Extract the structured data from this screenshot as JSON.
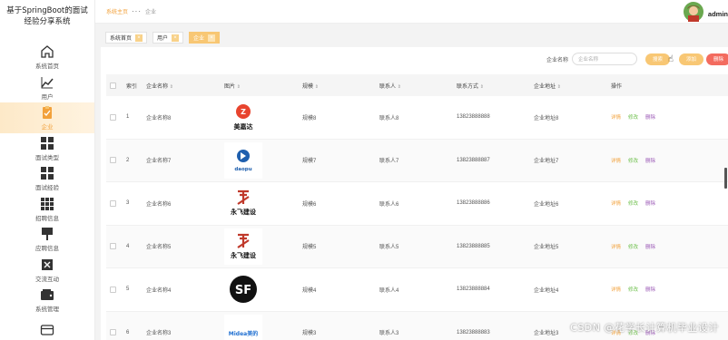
{
  "app": {
    "title": "基于SpringBoot的面试经验分享系统"
  },
  "sidebar": {
    "items": [
      {
        "label": "系统首页",
        "icon": "home-icon",
        "active": false
      },
      {
        "label": "用户",
        "icon": "chart-line-icon",
        "active": false
      },
      {
        "label": "企业",
        "icon": "clipboard-check-icon",
        "active": true
      },
      {
        "label": "面试类型",
        "icon": "grid-icon",
        "active": false
      },
      {
        "label": "面试经验",
        "icon": "grid-icon",
        "active": false
      },
      {
        "label": "招聘信息",
        "icon": "apps-icon",
        "active": false
      },
      {
        "label": "应聘信息",
        "icon": "pin-icon",
        "active": false
      },
      {
        "label": "交流互动",
        "icon": "chat-x-icon",
        "active": false
      },
      {
        "label": "系统管理",
        "icon": "wallet-icon",
        "active": false
      },
      {
        "label": "",
        "icon": "card-icon",
        "active": false
      }
    ]
  },
  "header": {
    "breadcrumb": [
      "系统主页",
      "···",
      "企业"
    ],
    "user": {
      "name": "admin",
      "icon": "avatar-icon"
    }
  },
  "tags": [
    {
      "label": "系统首页",
      "active": false
    },
    {
      "label": "用户",
      "active": false
    },
    {
      "label": "企业",
      "active": true
    }
  ],
  "search": {
    "label": "企业名称",
    "placeholder": "企业名称",
    "search_label": "搜索",
    "add_label": "添加",
    "delete_label": "删除"
  },
  "table": {
    "columns": [
      "索引",
      "企业名称",
      "图片",
      "规模",
      "联系人",
      "联系方式",
      "企业地址",
      "操作"
    ],
    "ops": {
      "detail": "详情",
      "edit": "修改",
      "delete": "删除"
    },
    "rows": [
      {
        "no": "1",
        "name": "企业名称8",
        "logo": "美嘉达",
        "scale": "规模8",
        "contact": "联系人8",
        "phone": "13823888888",
        "address": "企业地址8"
      },
      {
        "no": "2",
        "name": "企业名称7",
        "logo": "daopu",
        "scale": "规模7",
        "contact": "联系人7",
        "phone": "13823888887",
        "address": "企业地址7"
      },
      {
        "no": "3",
        "name": "企业名称6",
        "logo": "永飞建设",
        "scale": "规模6",
        "contact": "联系人6",
        "phone": "13823888886",
        "address": "企业地址6"
      },
      {
        "no": "4",
        "name": "企业名称5",
        "logo": "永飞建设",
        "scale": "规模5",
        "contact": "联系人5",
        "phone": "13823888885",
        "address": "企业地址5"
      },
      {
        "no": "5",
        "name": "企业名称4",
        "logo": "SF",
        "scale": "规模4",
        "contact": "联系人4",
        "phone": "13823888884",
        "address": "企业地址4"
      },
      {
        "no": "6",
        "name": "企业名称3",
        "logo": "Midea美的",
        "scale": "规模3",
        "contact": "联系人3",
        "phone": "13823888883",
        "address": "企业地址3"
      }
    ]
  },
  "watermark": "CSDN @花学长计算机毕业设计",
  "colors": {
    "accent": "#f2a13b",
    "tag_active": "#f8c774",
    "delete": "#f36b5f",
    "edit": "#6cbf4a",
    "remove": "#9b59b6"
  }
}
